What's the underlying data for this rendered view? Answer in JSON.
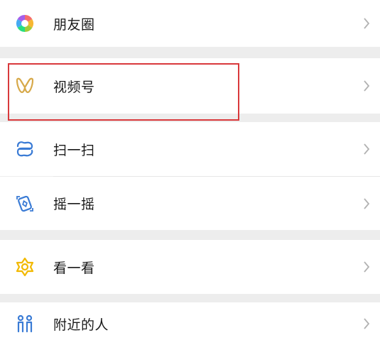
{
  "menu": {
    "items": [
      {
        "label": "朋友圈",
        "icon": "moments-icon"
      },
      {
        "label": "视频号",
        "icon": "channels-icon"
      },
      {
        "label": "扫一扫",
        "icon": "scan-icon"
      },
      {
        "label": "摇一摇",
        "icon": "shake-icon"
      },
      {
        "label": "看一看",
        "icon": "top-stories-icon"
      },
      {
        "label": "附近的人",
        "icon": "people-nearby-icon"
      }
    ]
  },
  "colors": {
    "background": "#ededed",
    "row": "#ffffff",
    "text": "#191919",
    "chevron": "#b2b2b2",
    "highlight": "#d9393c",
    "channels": "#d7a94a",
    "scan": "#3a7bd5",
    "look": "#f2b900"
  }
}
